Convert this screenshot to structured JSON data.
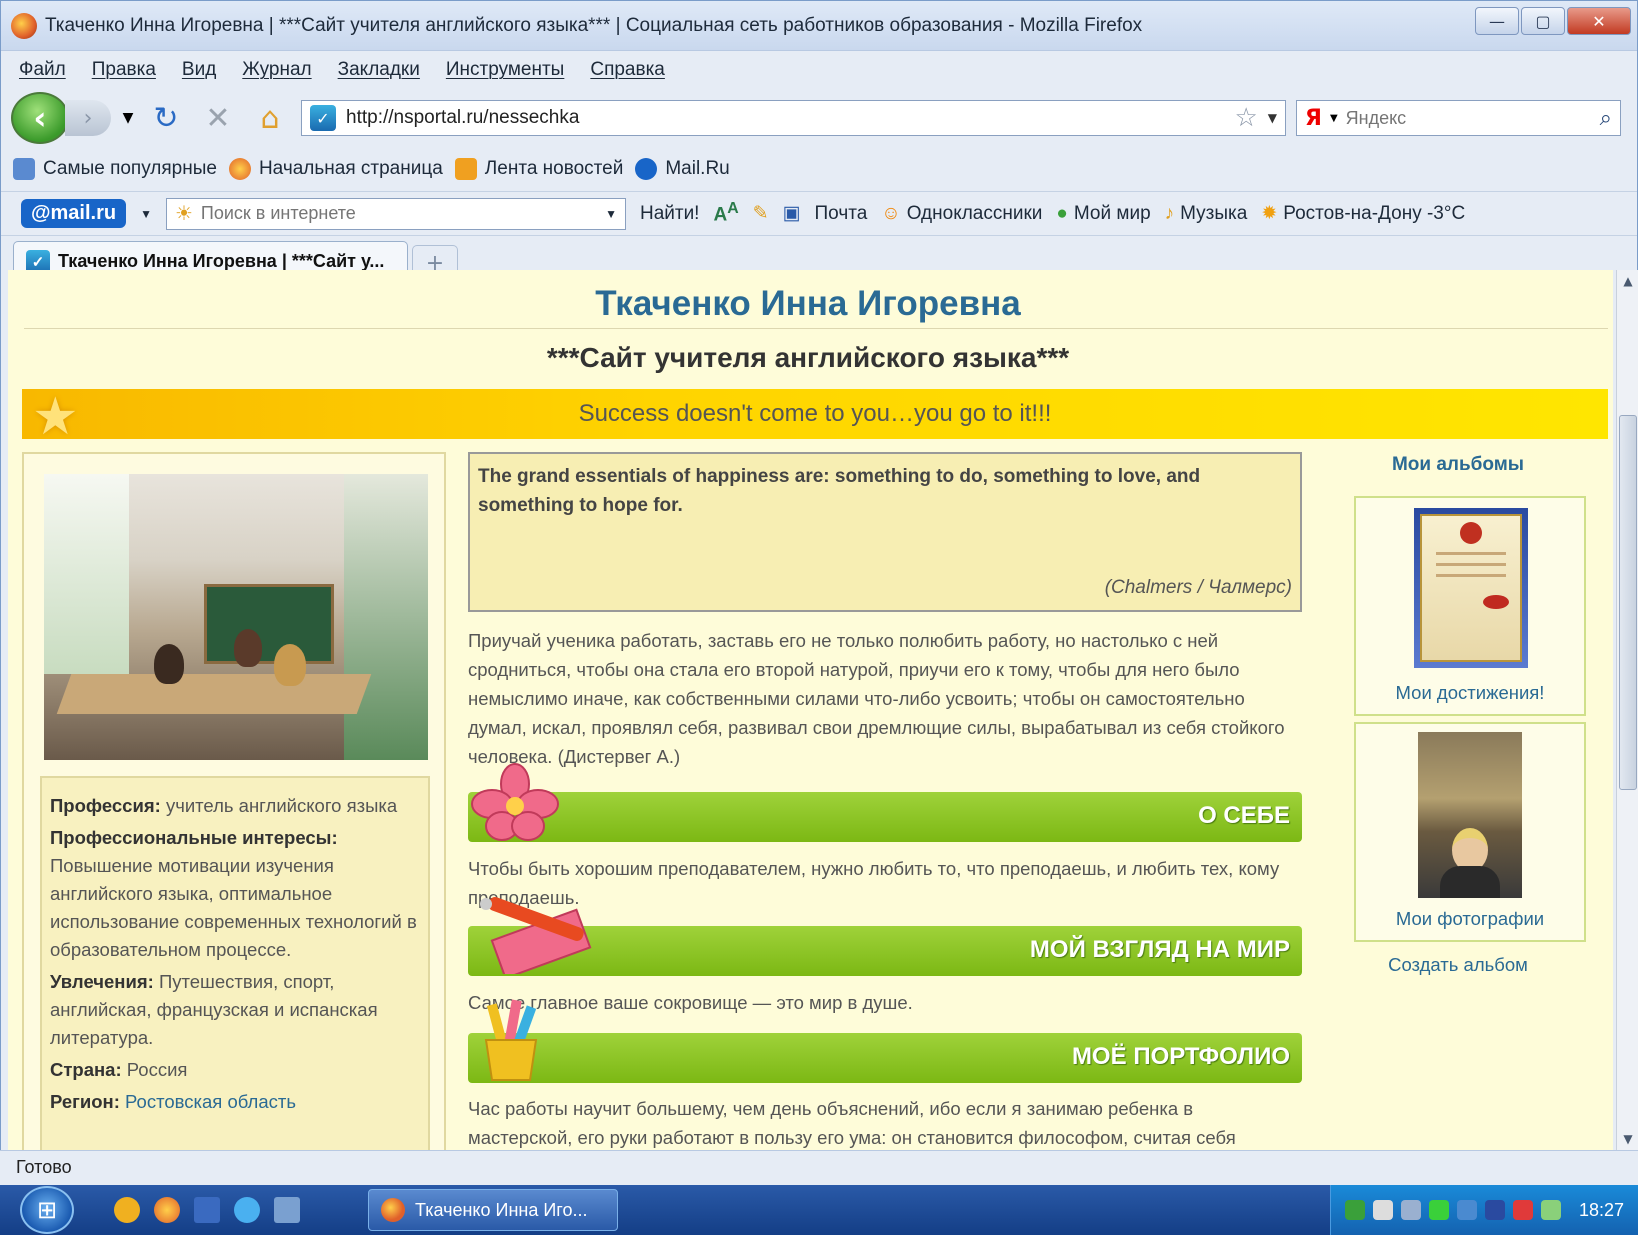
{
  "window": {
    "title": "Ткаченко Инна Игоревна | ***Сайт учителя английского языка*** | Социальная сеть работников образования - Mozilla Firefox"
  },
  "menu": [
    "Файл",
    "Правка",
    "Вид",
    "Журнал",
    "Закладки",
    "Инструменты",
    "Справка"
  ],
  "nav": {
    "url": "http://nsportal.ru/nessechka",
    "search_placeholder": "Яндекс",
    "search_engine": "Я"
  },
  "bookmarks": [
    "Самые популярные",
    "Начальная страница",
    "Лента новостей",
    "Mail.Ru"
  ],
  "mailbar": {
    "logo": "@mail.ru",
    "search_placeholder": "Поиск в интернете",
    "find_label": "Найти!",
    "items": [
      "Почта",
      "Одноклассники",
      "Мой мир",
      "Музыка",
      "Ростов-на-Дону -3°C"
    ]
  },
  "tab": {
    "label": "Ткаченко Инна Игоревна | ***Сайт у..."
  },
  "page": {
    "title": "Ткаченко Инна Игоревна",
    "subtitle": "***Сайт учителя английского языка***",
    "motto": "Success doesn't come to you…you go to it!!!",
    "quote": {
      "text": "The grand essentials of happiness are: something to do, something to love, and something to hope for.",
      "author": "(Chalmers / Чалмерс)"
    },
    "intro": "Приучай ученика работать, заставь его не только полюбить работу, но настолько с ней сродниться, чтобы она стала его второй натурой, приучи его к тому, чтобы для него было немыслимо иначе, как собственными силами что-либо усвоить; чтобы он самостоятельно думал, искал, проявлял себя, развивал свои дремлющие силы, вырабатывал из себя стойкого человека. (Дистервег А.)",
    "sections": [
      {
        "label": "О СЕБЕ",
        "text": "Чтобы быть хорошим преподавателем, нужно любить то, что преподаешь, и любить тех, кому преподаешь."
      },
      {
        "label": "МОЙ ВЗГЛЯД НА МИР",
        "text": "Самое главное ваше сокровище — это мир в душе."
      },
      {
        "label": "МОЁ ПОРТФОЛИО",
        "text": "Час работы научит большему, чем день объяснений, ибо если я занимаю ребенка в мастерской, его руки работают в пользу его ума: он становится философом, считая себя"
      }
    ],
    "profile": {
      "profession_label": "Профессия:",
      "profession": "учитель английского языка",
      "interests_label": "Профессиональные интересы:",
      "interests": "Повышение мотивации изучения английского языка, оптимальное использование современных технологий в образовательном процессе.",
      "hobbies_label": "Увлечения:",
      "hobbies": "Путешествия, спорт, английская, французская и испанская литература.",
      "country_label": "Страна:",
      "country": "Россия",
      "region_label": "Регион:",
      "region": "Ростовская область"
    },
    "albums": {
      "title": "Мои альбомы",
      "items": [
        "Мои достижения!",
        "Мои фотографии"
      ],
      "create": "Создать альбом"
    }
  },
  "status": "Готово",
  "taskbar": {
    "task_label": "Ткаченко Инна Иго...",
    "clock": "18:27"
  }
}
